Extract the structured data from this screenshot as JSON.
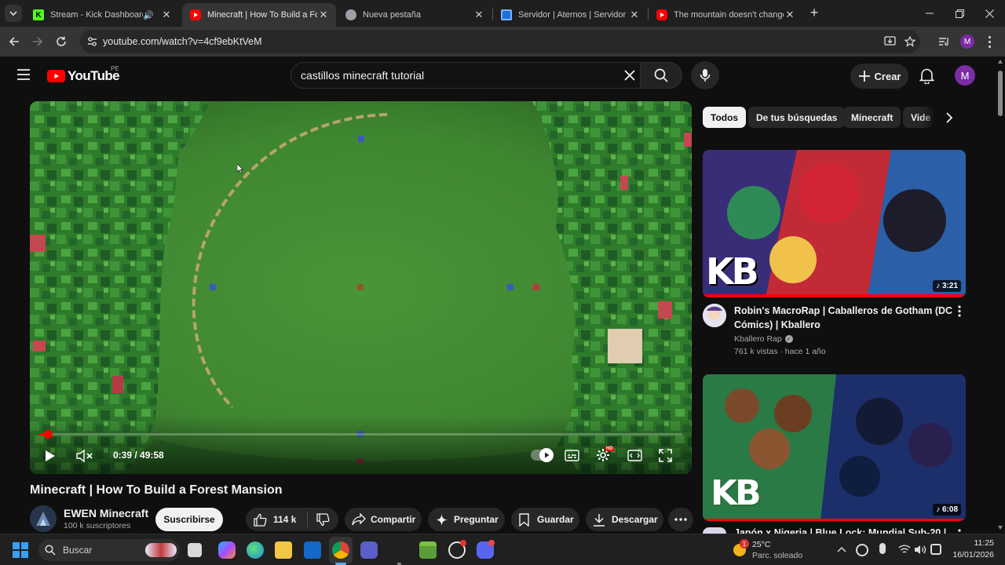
{
  "browser": {
    "tabs": [
      {
        "title": "Stream - Kick Dashboard",
        "favicon": "kick-icon",
        "color": "#53fc18"
      },
      {
        "title": "Minecraft | How To Build a Fore",
        "favicon": "youtube-icon",
        "color": "#ff0000",
        "active": true
      },
      {
        "title": "Nueva pestaña",
        "favicon": "chrome-icon",
        "color": "#9aa0a6"
      },
      {
        "title": "Servidor | Aternos | Servidor de",
        "favicon": "aternos-icon",
        "color": "#1e6fd9"
      },
      {
        "title": "The mountain doesn't change.",
        "favicon": "youtube-icon",
        "color": "#ff0000"
      }
    ],
    "url": "youtube.com/watch?v=4cf9ebKtVeM",
    "profile_initial": "M"
  },
  "yt": {
    "logo_text": "YouTube",
    "region": "PE",
    "search_value": "castillos minecraft tutorial",
    "create_label": "Crear",
    "avatar_initial": "M"
  },
  "player": {
    "time": "0:39 / 49:58",
    "progress": 0.013,
    "hd_badge": "HD"
  },
  "video": {
    "title": "Minecraft | How To Build a Forest Mansion",
    "channel": "EWEN Minecraft",
    "subscribers": "100 k suscriptores",
    "subscribe_label": "Suscribirse",
    "likes": "114 k",
    "share_label": "Compartir",
    "ask_label": "Preguntar",
    "save_label": "Guardar",
    "download_label": "Descargar"
  },
  "chips": [
    "Todos",
    "De tus búsquedas",
    "Minecraft",
    "Vide"
  ],
  "recommended": [
    {
      "title": "Robin's MacroRap | Caballeros de Gotham (DC Cómics) | Kballero",
      "channel": "Kballero Rap",
      "meta": "761 k vistas · hace 1 año",
      "duration": "3:21",
      "thumb_text": "KB"
    },
    {
      "title": "Japón x Nigeria | Blue Lock: Mundial Sub-20 |",
      "duration": "6:08",
      "thumb_text": "KB"
    }
  ],
  "taskbar": {
    "search_placeholder": "Buscar",
    "weather_temp": "25°C",
    "weather_desc": "Parc. soleado",
    "time": "11:25",
    "date": "16/01/2026",
    "notification_count": "1"
  }
}
